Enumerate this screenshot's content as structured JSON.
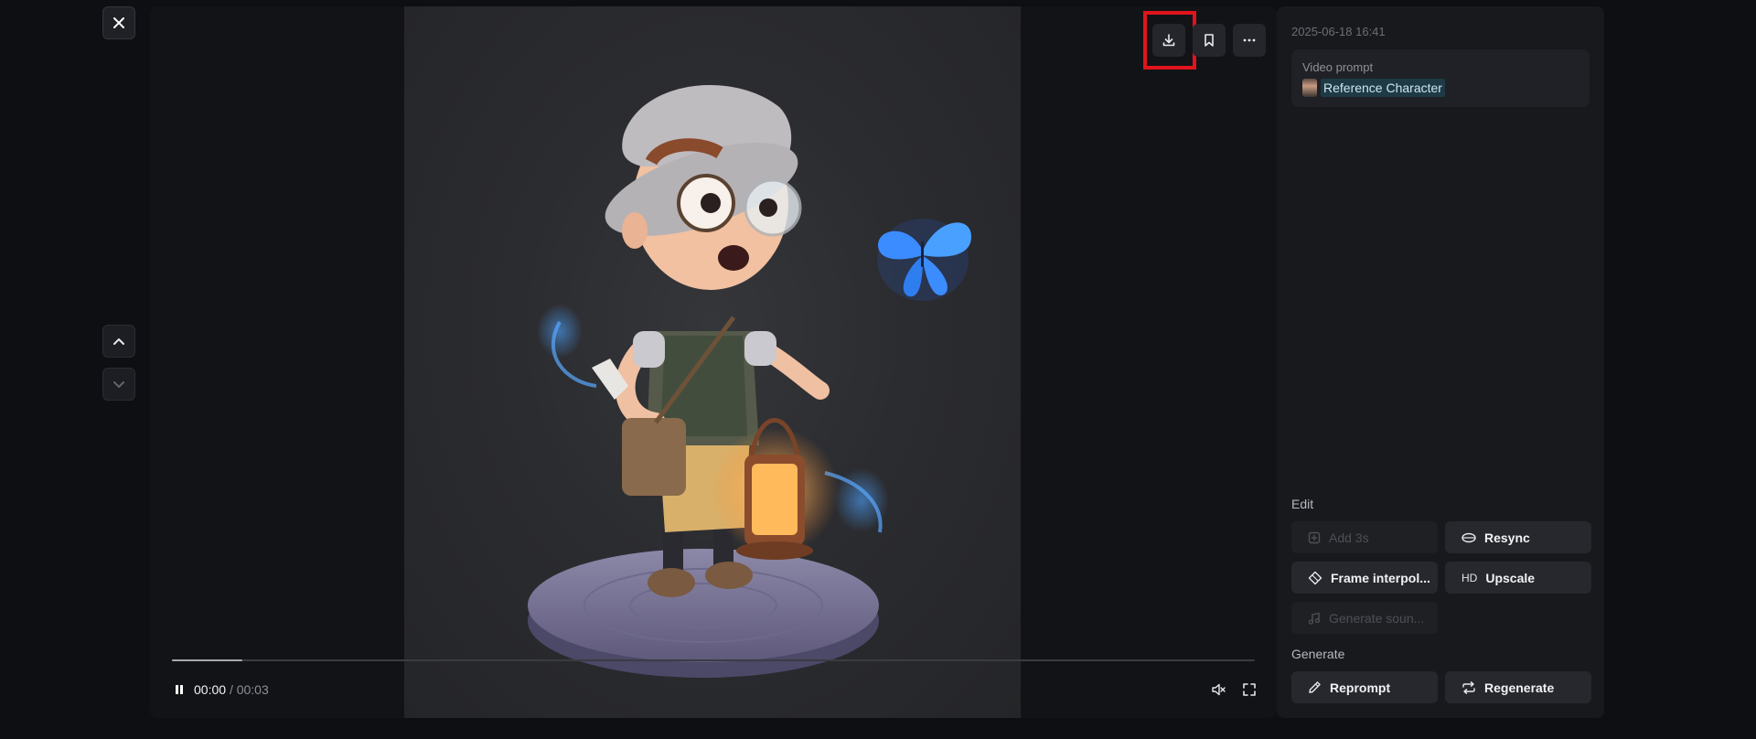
{
  "rail": {
    "close_icon": "close-icon",
    "up_icon": "chevron-up-icon",
    "down_icon": "chevron-down-icon"
  },
  "player": {
    "toolbar": {
      "download_icon": "download-icon",
      "bookmark_icon": "bookmark-icon",
      "more_icon": "more-horizontal-icon"
    },
    "progress_fraction": 0.065,
    "current_time": "00:00",
    "separator": "/",
    "duration": "00:03",
    "pause_icon": "pause-icon",
    "mute_icon": "speaker-mute-icon",
    "fullscreen_icon": "fullscreen-icon"
  },
  "panel": {
    "timestamp": "2025-06-18 16:41",
    "prompt_label": "Video prompt",
    "reference_name": "Reference Character",
    "edit_title": "Edit",
    "edit_buttons": {
      "add": "Add 3s",
      "resync": "Resync",
      "frame_interp": "Frame interpol...",
      "upscale": "Upscale",
      "upscale_badge": "HD",
      "generate_sound": "Generate soun..."
    },
    "generate_title": "Generate",
    "generate_buttons": {
      "reprompt": "Reprompt",
      "regenerate": "Regenerate"
    }
  },
  "colors": {
    "highlight": "#e0141c",
    "reference_chip_bg": "#1e3a44",
    "butterfly": "#3b8cff",
    "lantern_glow": "#ffb347"
  }
}
